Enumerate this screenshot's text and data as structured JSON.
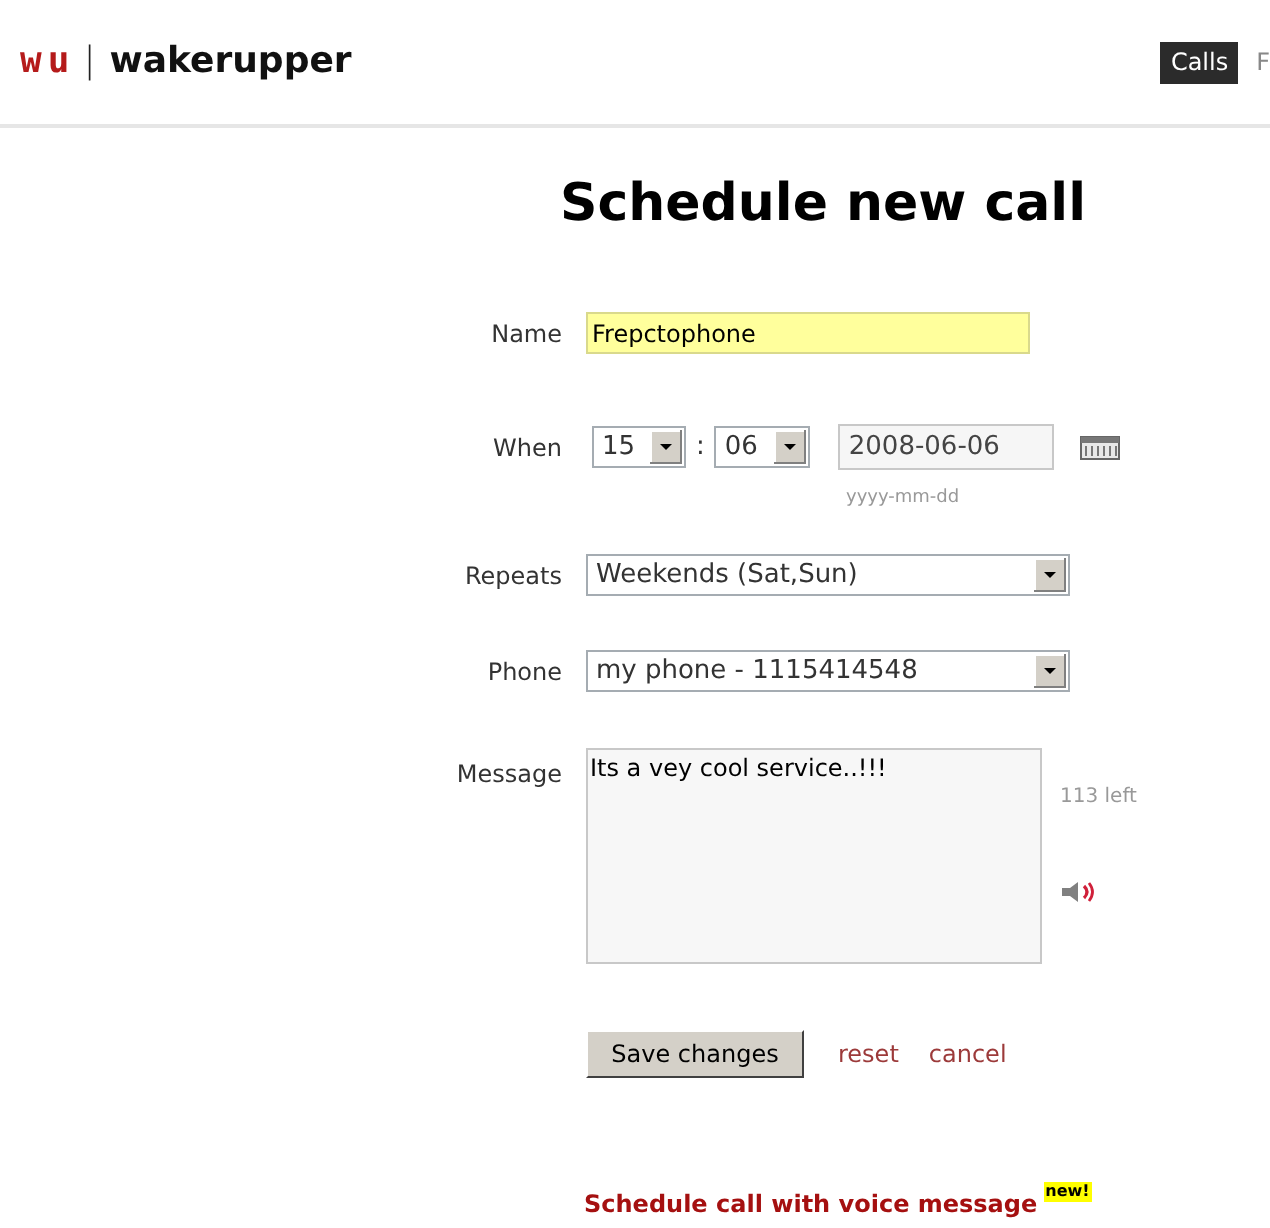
{
  "header": {
    "logo": "wu",
    "divider": "|",
    "site_name": "wakerupper",
    "nav": [
      {
        "label": "Calls",
        "selected": true
      },
      {
        "label": "F",
        "selected": false
      }
    ]
  },
  "title": "Schedule new call",
  "form": {
    "name": {
      "label": "Name",
      "value": "Frepctophone",
      "highlighted": true
    },
    "when": {
      "label": "When",
      "hour": "15",
      "separator": ":",
      "minute": "06",
      "date": "2008-06-06",
      "date_hint": "yyyy-mm-dd"
    },
    "repeats": {
      "label": "Repeats",
      "value": "Weekends (Sat,Sun)"
    },
    "phone": {
      "label": "Phone",
      "value": "my phone - 1115414548"
    },
    "message": {
      "label": "Message",
      "value": "Its a vey cool service..!!!",
      "remaining": "113 left"
    }
  },
  "actions": {
    "save": "Save changes",
    "reset": "reset",
    "cancel": "cancel"
  },
  "voice_link": {
    "label": "Schedule call with voice message",
    "badge": "new!"
  }
}
